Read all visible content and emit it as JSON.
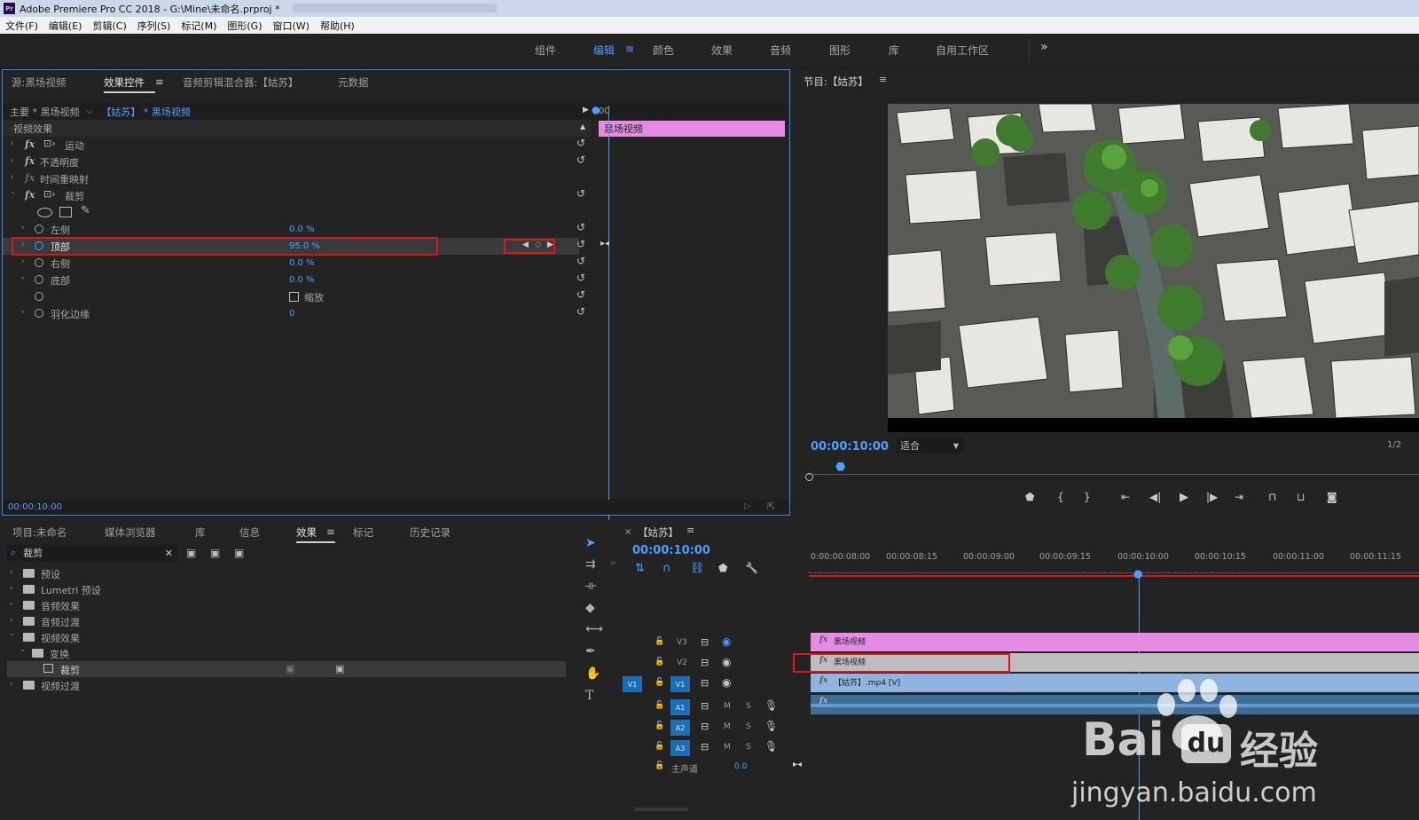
{
  "titlebar": {
    "icon": "Pr",
    "title": "Adobe Premiere Pro CC 2018 - G:\\Mine\\未命名.prproj *"
  },
  "menu": [
    "文件(F)",
    "编辑(E)",
    "剪辑(C)",
    "序列(S)",
    "标记(M)",
    "图形(G)",
    "窗口(W)",
    "帮助(H)"
  ],
  "workspaces": {
    "items": [
      "组件",
      "编辑",
      "颜色",
      "效果",
      "音频",
      "图形",
      "库",
      "自用工作区"
    ],
    "active": "编辑",
    "more": "»"
  },
  "effect_controls": {
    "tabs": [
      "源:黑场视频",
      "效果控件",
      "音频剪辑混合器:【姑苏】",
      "元数据"
    ],
    "active_tab": "效果控件",
    "master_label": "主要 * 黑场视频",
    "clip_label": "【姑苏】 * 黑场视频",
    "section": "视频效果",
    "effects": [
      "运动",
      "不透明度",
      "时间重映射",
      "裁剪"
    ],
    "params": [
      {
        "name": "左侧",
        "value": "0.0 %"
      },
      {
        "name": "顶部",
        "value": "95.0 %"
      },
      {
        "name": "右侧",
        "value": "0.0 %"
      },
      {
        "name": "底部",
        "value": "0.0 %"
      },
      {
        "name": "",
        "value": "缩放"
      },
      {
        "name": "羽化边缘",
        "value": "0"
      }
    ],
    "mini_timeline_time": "00",
    "mini_clip": "黑场视频",
    "current_time": "00:00:10:00"
  },
  "program": {
    "title": "节目:【姑苏】",
    "timecode": "00:00:10:00",
    "fit": "适合",
    "resolution": "1/2"
  },
  "project": {
    "tabs": [
      "项目:未命名",
      "媒体浏览器",
      "库",
      "信息",
      "效果",
      "标记",
      "历史记录"
    ],
    "active_tab": "效果",
    "search_value": "裁剪",
    "tree": [
      {
        "label": "预设",
        "level": 0,
        "open": false
      },
      {
        "label": "Lumetri 预设",
        "level": 0,
        "open": false
      },
      {
        "label": "音频效果",
        "level": 0,
        "open": false
      },
      {
        "label": "音频过渡",
        "level": 0,
        "open": false
      },
      {
        "label": "视频效果",
        "level": 0,
        "open": true
      },
      {
        "label": "变换",
        "level": 1,
        "open": true
      },
      {
        "label": "裁剪",
        "level": 2,
        "open": false
      },
      {
        "label": "视频过渡",
        "level": 0,
        "open": false
      }
    ]
  },
  "timeline": {
    "title": "【姑苏】",
    "timecode": "00:00:10:00",
    "ruler": [
      "0:00:00:08:00",
      "00:00:08:15",
      "00:00:09:00",
      "00:00:09:15",
      "00:00:10:00",
      "00:00:10:15",
      "00:00:11:00",
      "00:00:11:15"
    ],
    "video_tracks": [
      "V3",
      "V2",
      "V1"
    ],
    "source_patch": "V1",
    "audio_tracks": [
      "A1",
      "A2",
      "A3"
    ],
    "master": {
      "label": "主声道",
      "value": "0.0"
    },
    "clips": {
      "v3": "黑场视频",
      "v2": "黑场视频",
      "v1": "【姑苏】.mp4 [V]"
    },
    "mute_label": "M",
    "solo_label": "S"
  },
  "watermark": {
    "brand": "Bai",
    "brand2": "经验",
    "url": "jingyan.baidu.com"
  },
  "colors": {
    "accent": "#4c9eff",
    "clip_pink": "#e58be3",
    "clip_blue": "#8fb4e0",
    "highlight": "#e0151a"
  }
}
